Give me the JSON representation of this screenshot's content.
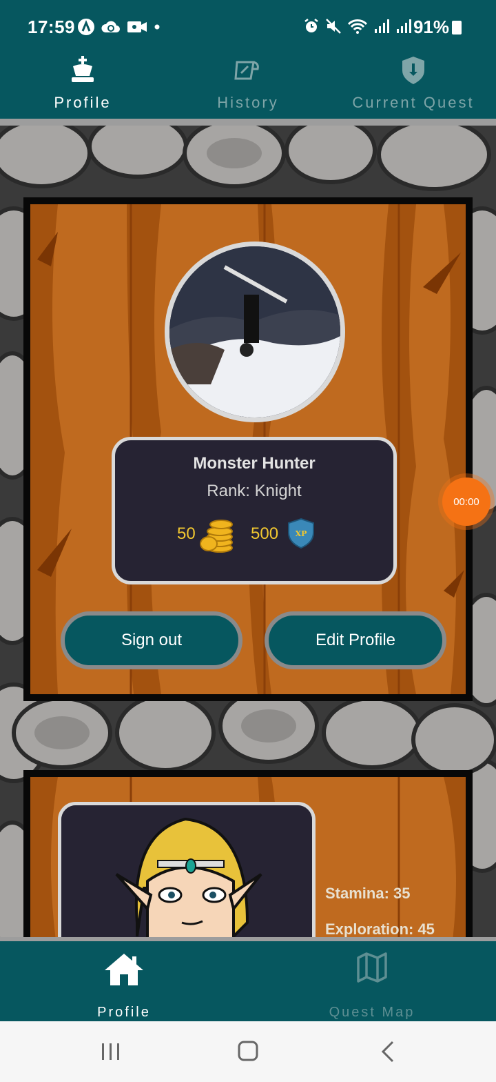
{
  "status_bar": {
    "time": "17:59",
    "battery": "91%",
    "left_icons": [
      "app-a-icon",
      "cloud-sync-icon",
      "video-camera-icon",
      "notification-dot-icon"
    ],
    "right_icons": [
      "alarm-icon",
      "mute-icon",
      "wifi-icon",
      "signal-icon",
      "signal-icon"
    ]
  },
  "top_tabs": [
    {
      "label": "Profile",
      "icon": "chess-king-icon",
      "active": true
    },
    {
      "label": "History",
      "icon": "scroll-icon",
      "active": false
    },
    {
      "label": "Current Quest",
      "icon": "shield-icon",
      "active": false
    }
  ],
  "profile": {
    "name": "Monster Hunter",
    "rank": "Rank: Knight",
    "coins": "50",
    "xp": "500",
    "xp_badge": "XP",
    "sign_out_label": "Sign out",
    "edit_profile_label": "Edit Profile"
  },
  "character": {
    "stats": [
      "Stamina: 35",
      "Exploration: 45"
    ]
  },
  "timer": {
    "value": "00:00"
  },
  "bottom_nav": [
    {
      "label": "Profile",
      "icon": "home-icon",
      "active": true
    },
    {
      "label": "Quest Map",
      "icon": "map-icon",
      "active": false
    }
  ],
  "colors": {
    "primary": "#06575f",
    "wood": "#b8621a",
    "panel": "#262333",
    "gold": "#f2c830",
    "timer": "#f57214"
  }
}
